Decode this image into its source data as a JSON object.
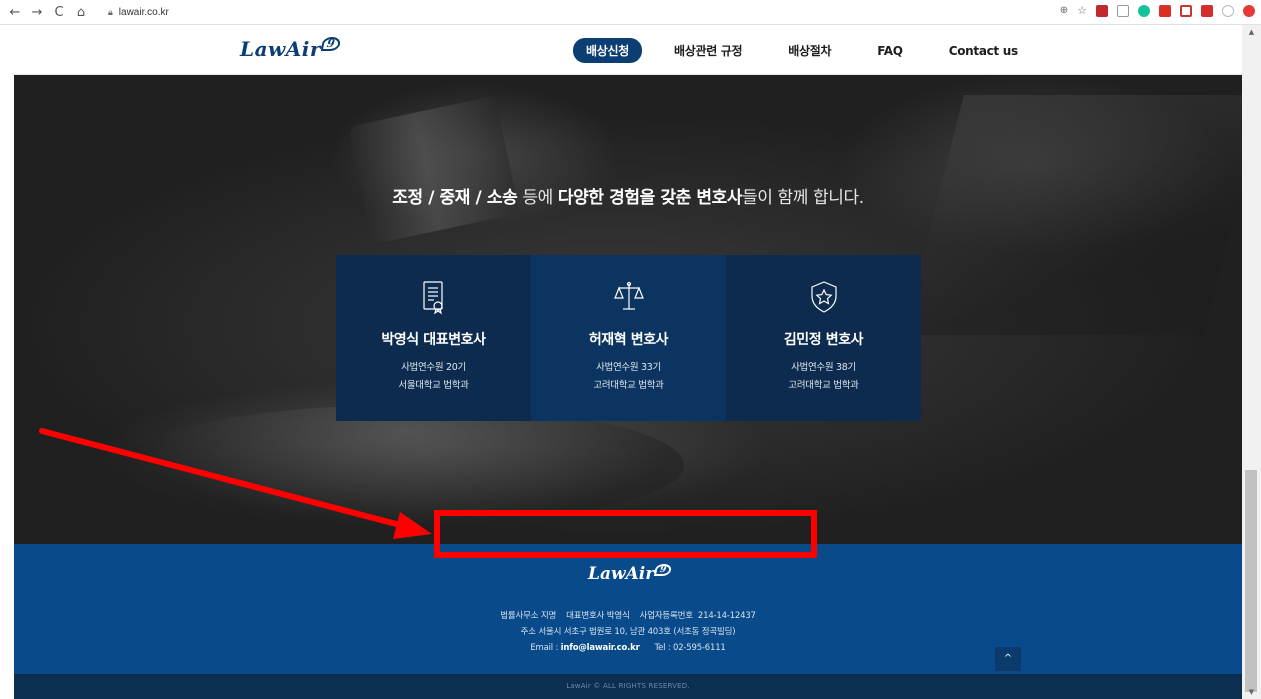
{
  "browser": {
    "back_icon": "←",
    "forward_icon": "→",
    "reload_icon": "C",
    "home_icon": "⌂",
    "url": "lawair.co.kr"
  },
  "header": {
    "logo_text": "LawAir",
    "logo_badge": "9",
    "menu": [
      {
        "label": "배상신청",
        "active": true
      },
      {
        "label": "배상관련 규정"
      },
      {
        "label": "배상절차"
      },
      {
        "label": "FAQ"
      },
      {
        "label": "Contact us"
      }
    ]
  },
  "hero": {
    "tagline": {
      "part1": "조정 / 중재 / 소송",
      "part2": " 등에 ",
      "part3": "다양한 경험을 갖춘 변호사",
      "part4": "들이 함께 합니다."
    },
    "cards": [
      {
        "name": "박영식 대표변호사",
        "line1": "사법연수원 20기",
        "line2": "서울대학교 법학과",
        "icon": "document-certificate-icon"
      },
      {
        "name": "허재혁 변호사",
        "line1": "사법연수원 33기",
        "line2": "고려대학교 법학과",
        "icon": "scales-justice-icon"
      },
      {
        "name": "김민정 변호사",
        "line1": "사법연수원 38기",
        "line2": "고려대학교 법학과",
        "icon": "shield-star-icon"
      }
    ]
  },
  "footer": {
    "logo_text": "LawAir",
    "logo_badge": "9",
    "line1": "법률사무소 지명    대표변호사 박영식    사업자등록번호  214-14-12437",
    "line2": "주소  서울시 서초구 법원로 10, 남관 403호 (서초동 정곡빌딩)",
    "email_label": "Email : ",
    "email": "info@lawair.co.kr",
    "tel": "Tel : 02-595-6111",
    "to_top": "^",
    "copyright": "LawAir © ALL RIGHTS RESERVED."
  },
  "colors": {
    "brand": "#0c3d73",
    "footer": "#084a8a",
    "annotation": "#ff0000"
  }
}
